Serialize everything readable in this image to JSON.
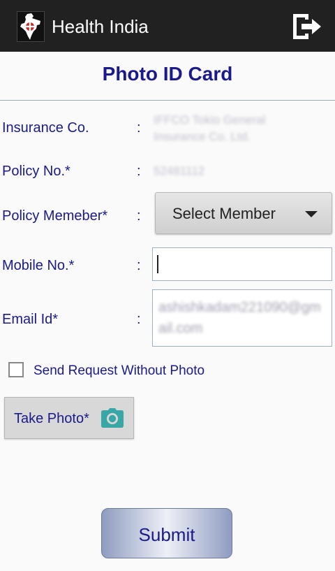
{
  "app_bar": {
    "title": "Health India",
    "logo_icon": "india-map-logo-icon",
    "exit_icon": "logout-icon"
  },
  "page": {
    "title": "Photo ID Card"
  },
  "form": {
    "colon": ":",
    "insurance": {
      "label": "Insurance Co.",
      "value": "IFFCO Tokio General Insurance Co. Ltd."
    },
    "policy_no": {
      "label": "Policy No.*",
      "value": "52481112"
    },
    "policy_member": {
      "label": "Policy Memeber*",
      "selected": "Select Member"
    },
    "mobile": {
      "label": "Mobile No.*",
      "value": ""
    },
    "email": {
      "label": "Email Id*",
      "value": "ashishkadam221090@gmail.com"
    },
    "send_without_photo": {
      "label": "Send Request Without Photo",
      "checked": false
    },
    "take_photo": {
      "label": "Take Photo*",
      "icon": "camera-icon"
    },
    "submit": {
      "label": "Submit"
    }
  },
  "colors": {
    "app_bar": "#212121",
    "label": "#1a1a8a",
    "camera_icon": "#3aa7a7"
  }
}
